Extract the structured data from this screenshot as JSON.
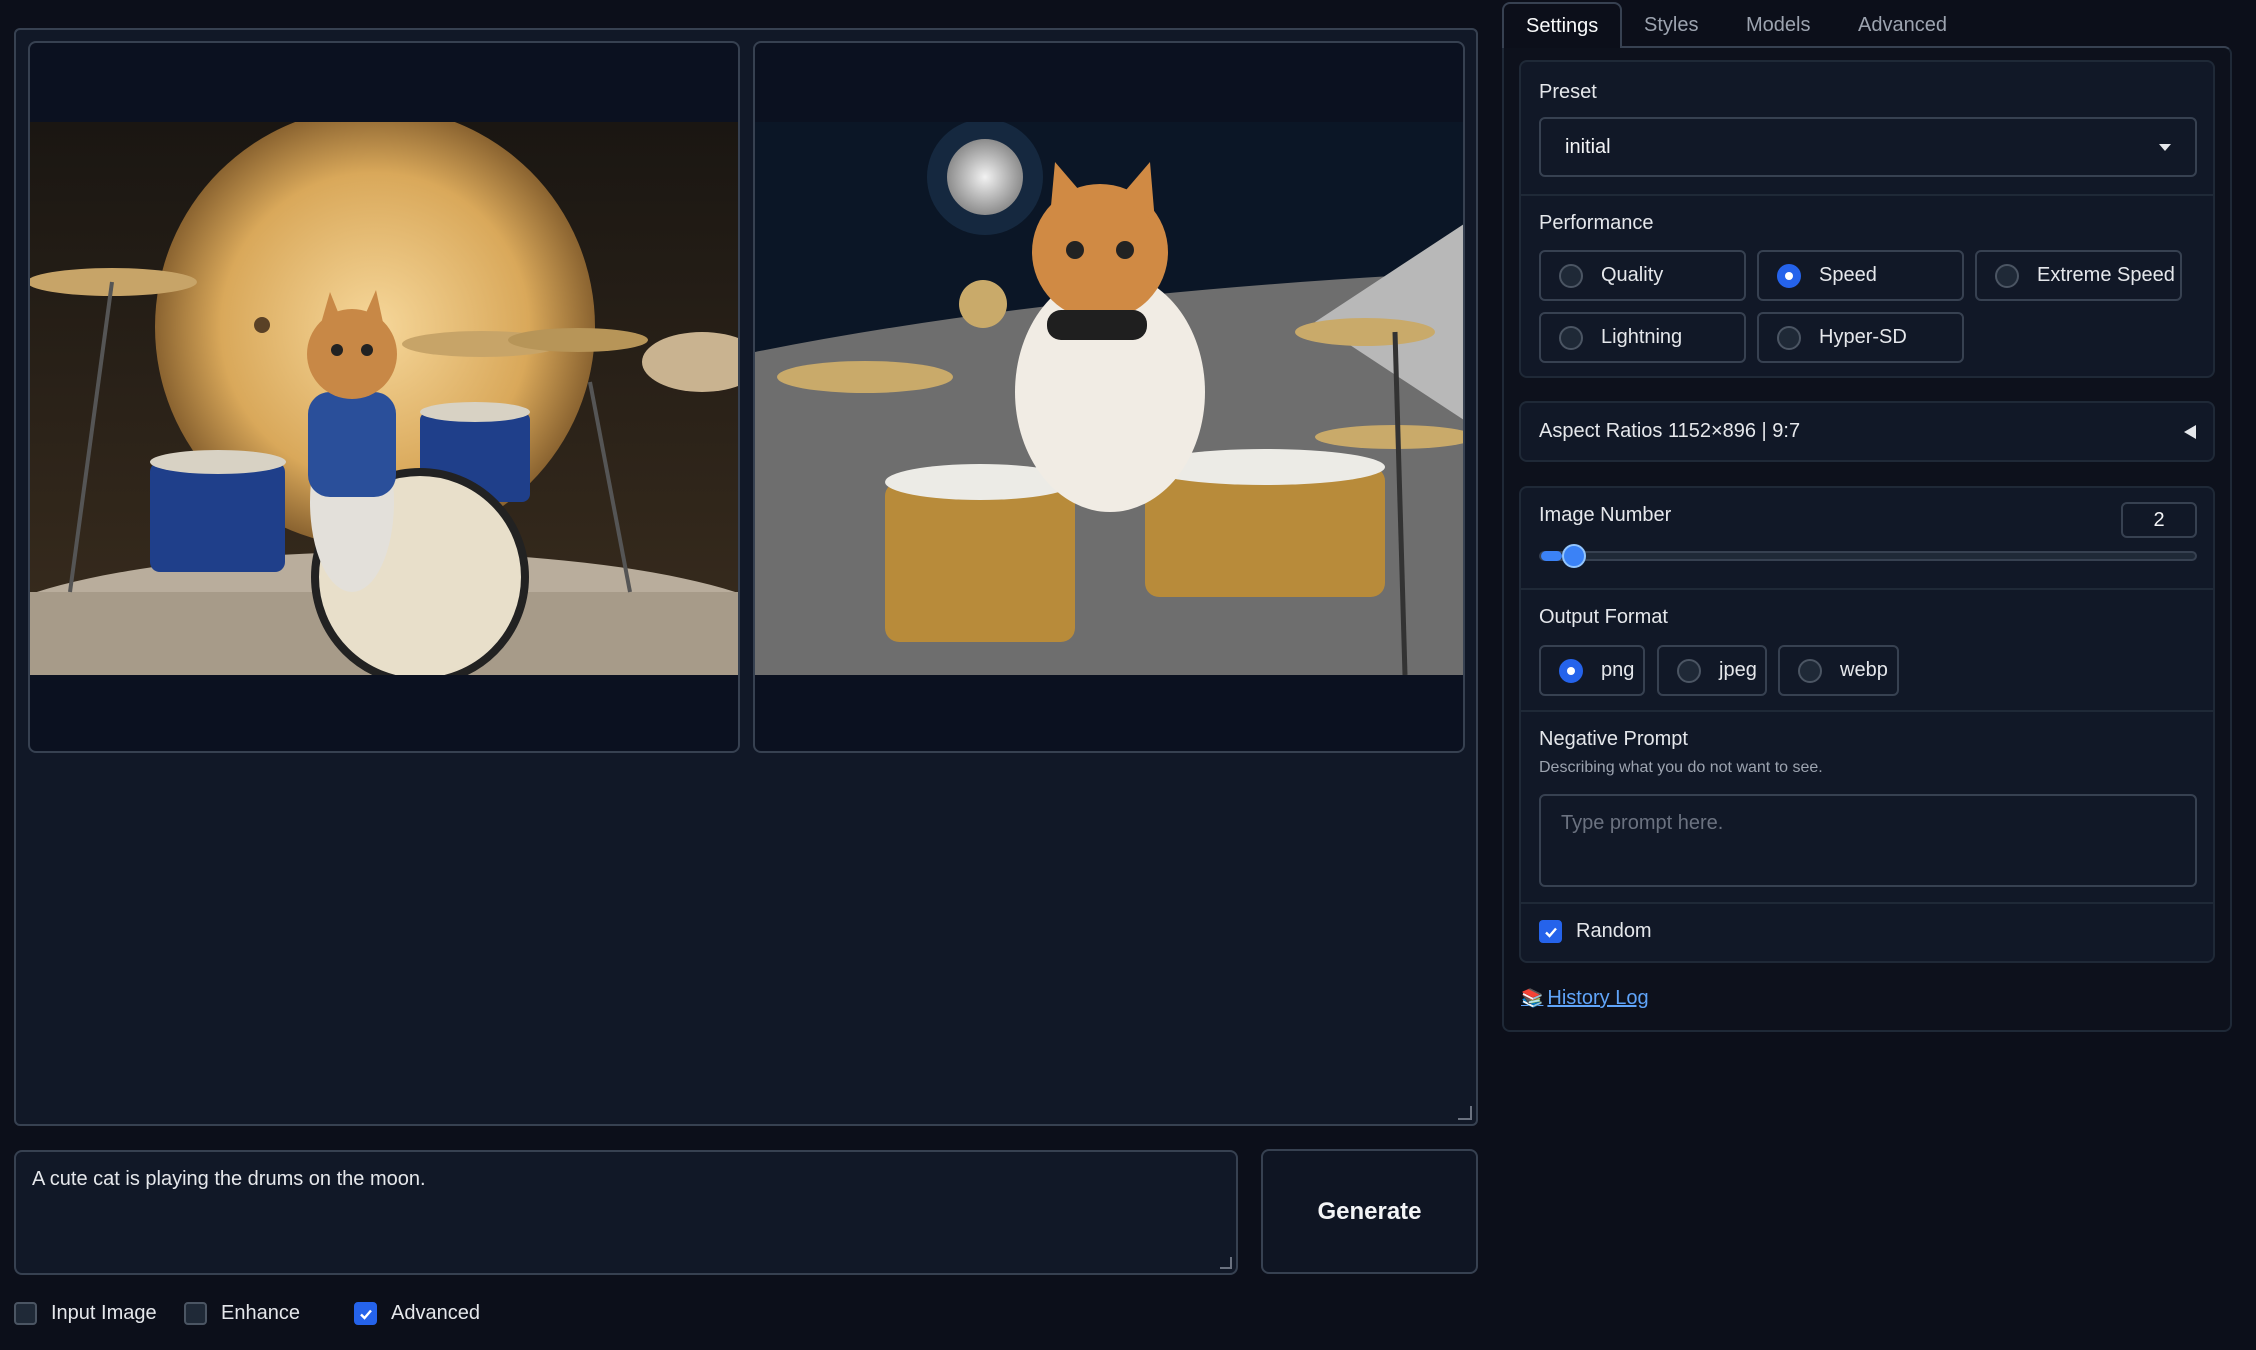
{
  "prompt": {
    "value": "A cute cat is playing the drums on the moon."
  },
  "generate": {
    "label": "Generate"
  },
  "options": {
    "input_image": {
      "label": "Input Image",
      "checked": false
    },
    "enhance": {
      "label": "Enhance",
      "checked": false
    },
    "advanced": {
      "label": "Advanced",
      "checked": true
    }
  },
  "tabs": [
    "Settings",
    "Styles",
    "Models",
    "Advanced"
  ],
  "settings": {
    "preset": {
      "label": "Preset",
      "value": "initial"
    },
    "performance": {
      "label": "Performance",
      "options": [
        "Quality",
        "Speed",
        "Extreme Speed",
        "Lightning",
        "Hyper-SD"
      ],
      "selected": "Speed"
    },
    "aspect_ratios": {
      "label": "Aspect Ratios 1152×896 | 9:7"
    },
    "image_number": {
      "label": "Image Number",
      "value": "2",
      "min": 1,
      "max": 32
    },
    "output_format": {
      "label": "Output Format",
      "options": [
        "png",
        "jpeg",
        "webp"
      ],
      "selected": "png"
    },
    "negative_prompt": {
      "label": "Negative Prompt",
      "description": "Describing what you do not want to see.",
      "placeholder": "Type prompt here."
    },
    "random": {
      "label": "Random",
      "checked": true
    }
  },
  "history_log": {
    "label": "History Log"
  },
  "colors": {
    "accent": "#2563eb",
    "background": "#0c0f1a",
    "link": "#60a5fa"
  }
}
